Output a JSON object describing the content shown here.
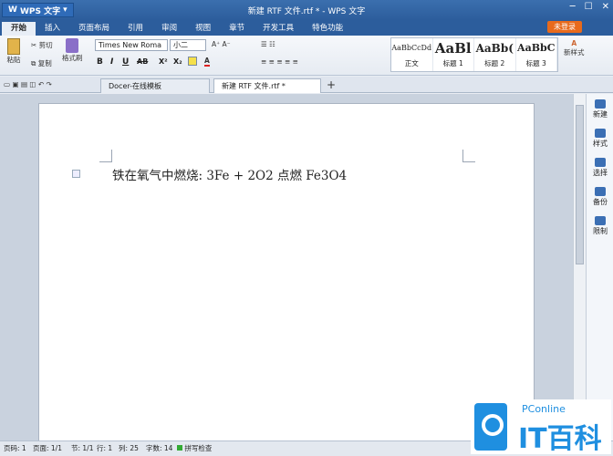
{
  "app": {
    "name": "WPS 文字",
    "window_title": "新建 RTF 文件.rtf * - WPS 文字"
  },
  "menu_tabs": [
    "开始",
    "插入",
    "页面布局",
    "引用",
    "审阅",
    "视图",
    "章节",
    "开发工具",
    "特色功能"
  ],
  "login_label": "未登录",
  "ribbon": {
    "paste": "粘贴",
    "cut": "剪切",
    "copy": "复制",
    "format_painter": "格式刷",
    "font_name": "Times New Roma",
    "font_size": "小二",
    "bold": "B",
    "italic": "I",
    "underline": "U",
    "strike": "AB",
    "super": "X²",
    "sub": "X₂",
    "styles": [
      {
        "sample": "AaBbCcDd",
        "label": "正文"
      },
      {
        "sample": "AaBl",
        "label": "标题 1"
      },
      {
        "sample": "AaBb(",
        "label": "标题 2"
      },
      {
        "sample": "AaBbC",
        "label": "标题 3"
      }
    ],
    "new_style": "新样式"
  },
  "doc_tabs": [
    {
      "label": "Docer-在线模板"
    },
    {
      "label": "新建 RTF 文件.rtf *"
    }
  ],
  "document": {
    "text": "铁在氧气中燃烧: 3Fe + 2O2 点燃 Fe3O4"
  },
  "right_pane": [
    "新建",
    "样式",
    "选择",
    "备份",
    "限制"
  ],
  "status": {
    "page": "页码: 1",
    "pages": "页面: 1/1",
    "section": "节: 1/1",
    "line": "行: 1",
    "column": "列: 25",
    "words": "字数: 14",
    "spell": "拼写检查"
  },
  "watermark": {
    "small": "PConline",
    "big": "IT百科"
  }
}
